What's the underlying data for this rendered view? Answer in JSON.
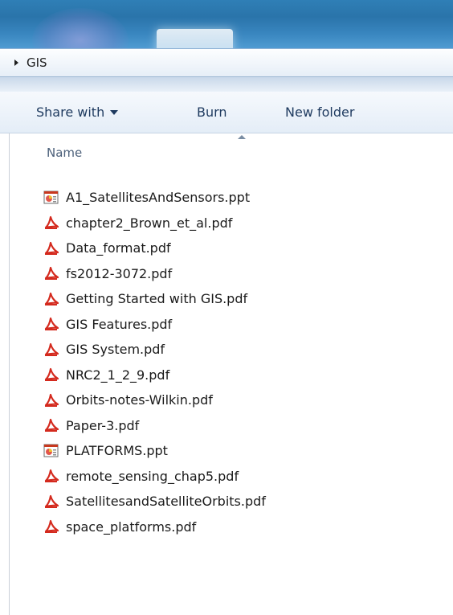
{
  "address": {
    "path": "GIS"
  },
  "toolbar": {
    "share_label": "Share with",
    "burn_label": "Burn",
    "new_folder_label": "New folder"
  },
  "list_header": {
    "name_label": "Name"
  },
  "files": [
    {
      "name": "A1_SatellitesAndSensors.ppt",
      "icon": "ppt-icon"
    },
    {
      "name": "chapter2_Brown_et_al.pdf",
      "icon": "pdf-icon"
    },
    {
      "name": "Data_format.pdf",
      "icon": "pdf-icon"
    },
    {
      "name": "fs2012-3072.pdf",
      "icon": "pdf-icon"
    },
    {
      "name": "Getting Started with GIS.pdf",
      "icon": "pdf-icon"
    },
    {
      "name": "GIS Features.pdf",
      "icon": "pdf-icon"
    },
    {
      "name": "GIS System.pdf",
      "icon": "pdf-icon"
    },
    {
      "name": "NRC2_1_2_9.pdf",
      "icon": "pdf-icon"
    },
    {
      "name": "Orbits-notes-Wilkin.pdf",
      "icon": "pdf-icon"
    },
    {
      "name": "Paper-3.pdf",
      "icon": "pdf-icon"
    },
    {
      "name": "PLATFORMS.ppt",
      "icon": "ppt-icon"
    },
    {
      "name": "remote_sensing_chap5.pdf",
      "icon": "pdf-icon"
    },
    {
      "name": "SatellitesandSatelliteOrbits.pdf",
      "icon": "pdf-icon"
    },
    {
      "name": "space_platforms.pdf",
      "icon": "pdf-icon"
    }
  ],
  "colors": {
    "pdf_red": "#d42a1e",
    "ppt_red": "#c8381f",
    "toolbar_text": "#1e3a5f"
  }
}
